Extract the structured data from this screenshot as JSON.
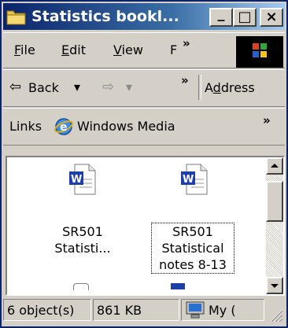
{
  "window": {
    "title": "Statistics bookl..."
  },
  "caption_buttons": {
    "minimize": "_",
    "maximize": "□",
    "close": "×"
  },
  "menu": {
    "items": [
      {
        "label": "File",
        "mnemonic": "F",
        "rest": "ile"
      },
      {
        "label": "Edit",
        "mnemonic": "E",
        "rest": "dit"
      },
      {
        "label": "View",
        "mnemonic": "V",
        "rest": "iew"
      },
      {
        "label": "F"
      }
    ],
    "overflow": "»"
  },
  "toolbar": {
    "back_label": "Back",
    "back_arrow": "⇦",
    "forward_arrow": "⇨",
    "dropdown": "▾",
    "overflow": "»",
    "address_prefix": "A",
    "address_mnemonic": "d",
    "address_rest": "dress"
  },
  "links_bar": {
    "label": "Links",
    "item": "Windows Media",
    "overflow": "»"
  },
  "files": [
    {
      "label_line1": "SR501",
      "label_line2": "Statisti...",
      "label_line3": "",
      "selected": false
    },
    {
      "label_line1": "SR501",
      "label_line2": "Statistical",
      "label_line3": "notes 8-13",
      "selected": true
    }
  ],
  "status_bar": {
    "objects": "6 object(s)",
    "size": "861 KB",
    "zone": "My ("
  },
  "colors": {
    "title_start": "#0a246a",
    "title_end": "#a6caf0",
    "word_blue": "#1f3fa8",
    "face": "#d4d0c8"
  },
  "icons": [
    "folder-icon",
    "windows-logo-icon",
    "back-arrow-icon",
    "forward-arrow-icon",
    "ie-icon",
    "word-document-icon",
    "my-computer-icon"
  ]
}
